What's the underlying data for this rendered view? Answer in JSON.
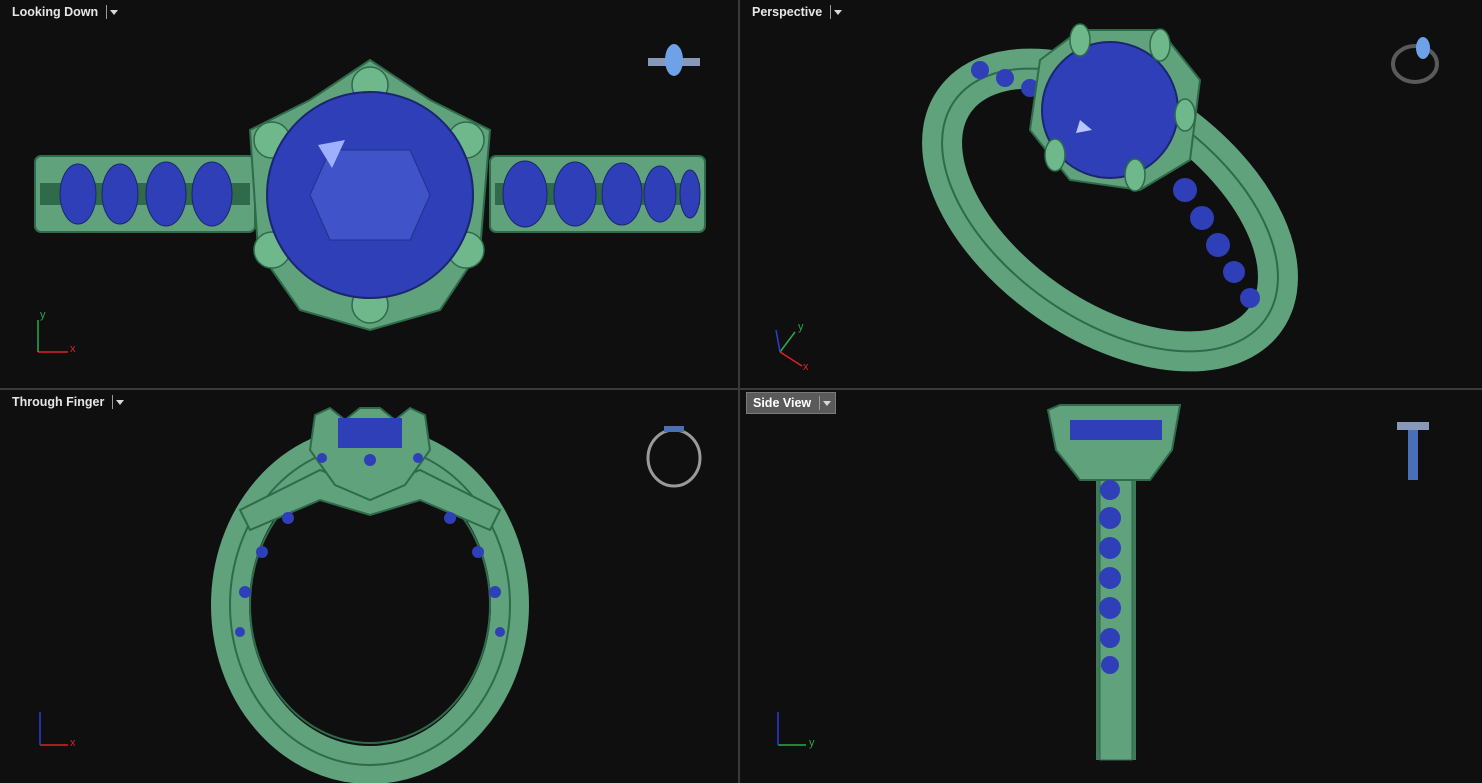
{
  "viewports": {
    "top_left": {
      "label": "Looking Down",
      "axes": [
        "y",
        "x"
      ]
    },
    "top_right": {
      "label": "Perspective",
      "axes": [
        "y",
        "x"
      ]
    },
    "bottom_left": {
      "label": "Through Finger",
      "axes": [
        "x"
      ]
    },
    "bottom_right": {
      "label": "Side View",
      "axes": [
        "y"
      ]
    }
  },
  "colors": {
    "metal": "#5fa27c",
    "metal_dark": "#2f6a4a",
    "gem": "#2e3fb8",
    "gem_light": "#6b7ff0",
    "background": "#0f0f10",
    "axis_x": "#d9222a",
    "axis_y": "#2aa84a",
    "axis_z": "#2a3fd8"
  },
  "icons": [
    "ring-thumbnail-icon",
    "axis-triad-icon",
    "viewport-menu-arrow-icon"
  ]
}
